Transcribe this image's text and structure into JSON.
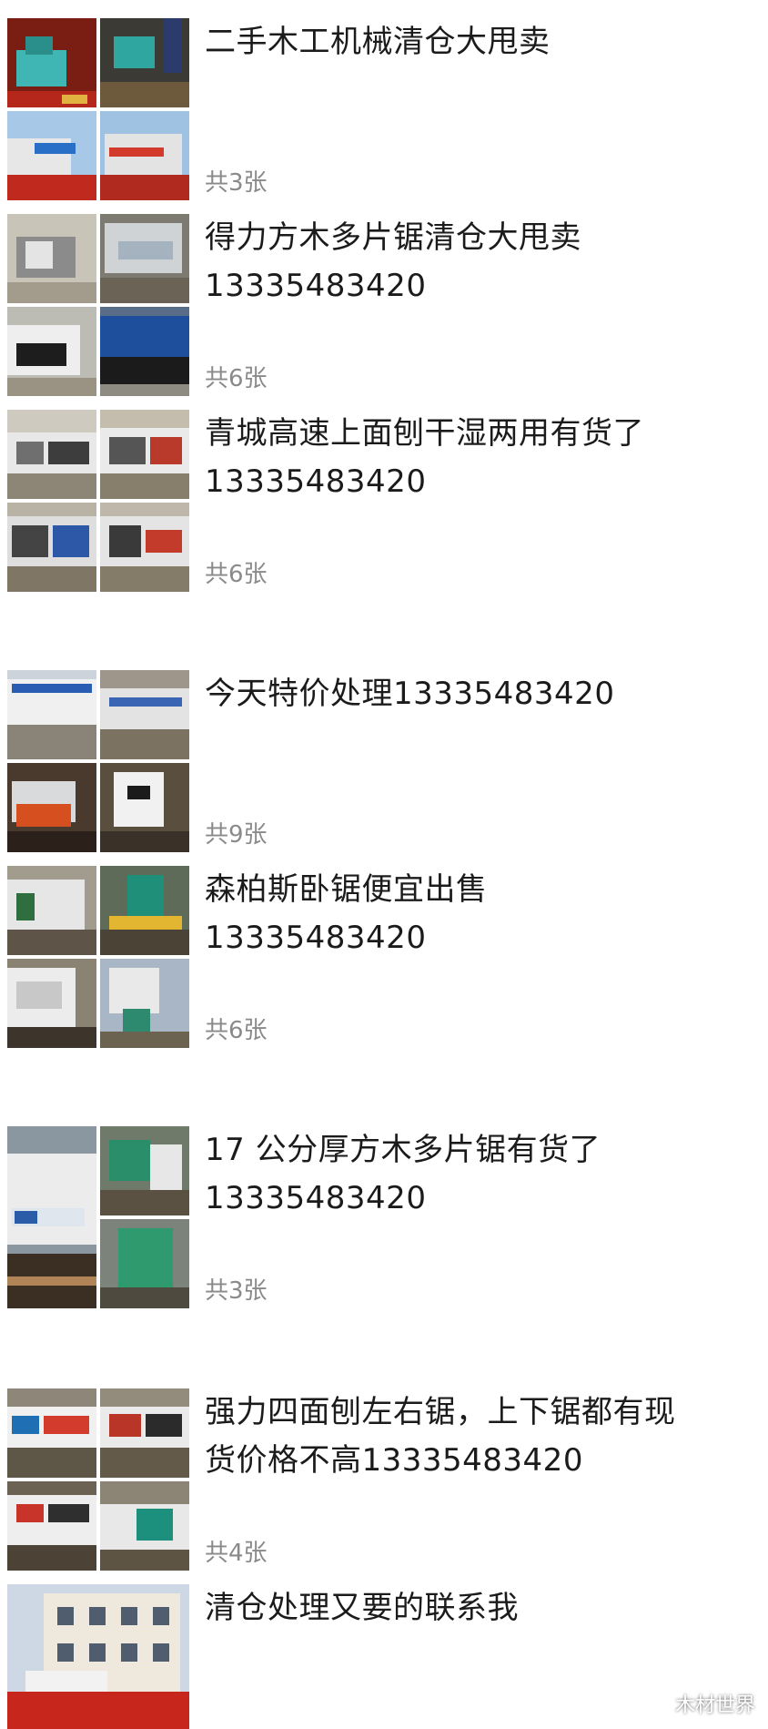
{
  "posts": [
    {
      "lines": [
        "二手木工机械清仓大甩卖"
      ],
      "count": "共3张"
    },
    {
      "lines": [
        "得力方木多片锯清仓大甩卖",
        "13335483420"
      ],
      "count": "共6张"
    },
    {
      "lines": [
        "青城高速上面刨干湿两用有货了",
        "13335483420"
      ],
      "count": "共6张"
    },
    {
      "lines": [
        "今天特价处理13335483420"
      ],
      "count": "共9张"
    },
    {
      "lines": [
        "森柏斯卧锯便宜出售",
        "13335483420"
      ],
      "count": "共6张"
    },
    {
      "lines": [
        "17 公分厚方木多片锯有货了",
        "13335483420"
      ],
      "count": "共3张"
    },
    {
      "lines": [
        "强力四面刨左右锯，上下锯都有现",
        "货价格不高13335483420"
      ],
      "count": "共4张"
    },
    {
      "lines": [
        "清仓处理又要的联系我"
      ],
      "count": ""
    }
  ],
  "watermark": {
    "icon": "wechat-icon",
    "text": "木材世界"
  }
}
